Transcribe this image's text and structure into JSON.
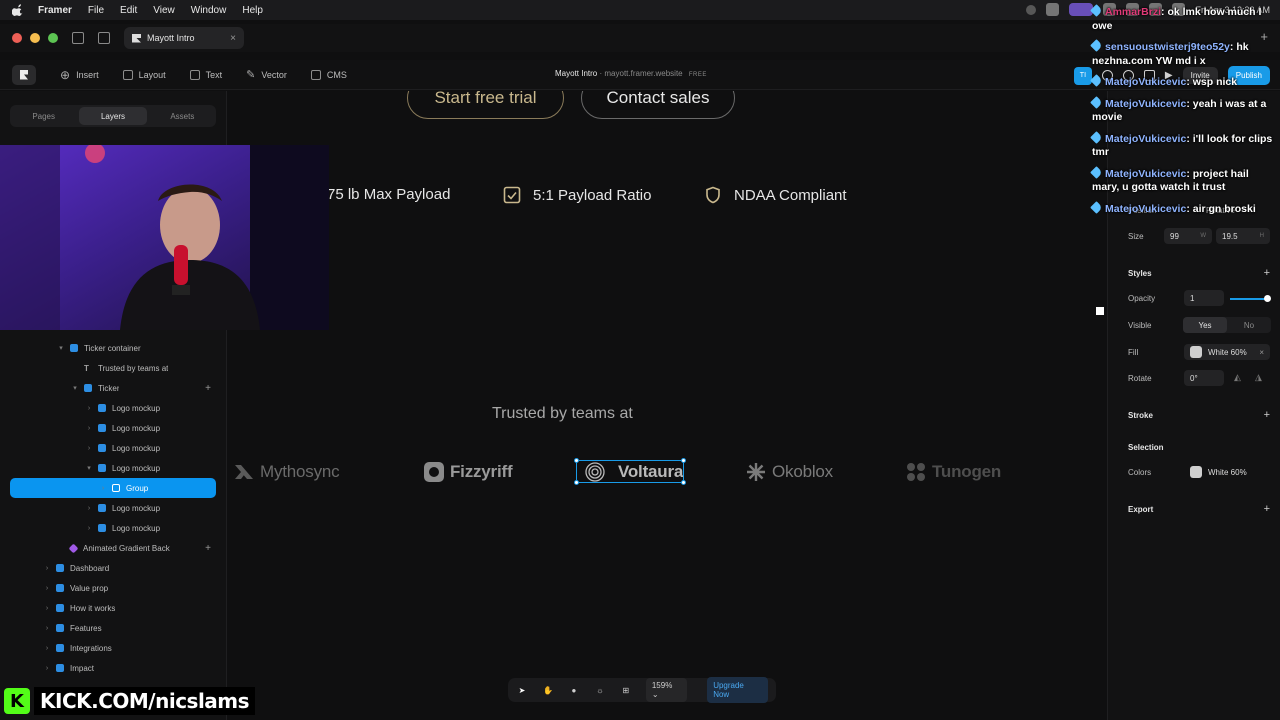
{
  "menubar": {
    "app": "Framer",
    "items": [
      "File",
      "Edit",
      "View",
      "Window",
      "Help"
    ],
    "clock": "Fri Apr 3  12:33 AM"
  },
  "tabbar": {
    "doc_tab": "Mayott Intro"
  },
  "toolbar": {
    "items": [
      "Insert",
      "Layout",
      "Text",
      "Vector",
      "CMS"
    ],
    "title": "Mayott Intro",
    "site": "mayott.framer.website",
    "plan": "FREE",
    "avatar": "TI",
    "invite": "Invite",
    "publish": "Publish"
  },
  "left_panel": {
    "tabs": [
      "Pages",
      "Layers",
      "Assets"
    ],
    "active_tab": "Layers",
    "layers": [
      {
        "label": "Ticker container",
        "depth": 2,
        "caret": "▾",
        "kind": "frame"
      },
      {
        "label": "Trusted by teams at",
        "depth": 3,
        "caret": "",
        "kind": "text"
      },
      {
        "label": "Ticker",
        "depth": 3,
        "caret": "▾",
        "kind": "frame",
        "plus": true
      },
      {
        "label": "Logo mockup",
        "depth": 4,
        "caret": "›",
        "kind": "frame"
      },
      {
        "label": "Logo mockup",
        "depth": 4,
        "caret": "›",
        "kind": "frame"
      },
      {
        "label": "Logo mockup",
        "depth": 4,
        "caret": "›",
        "kind": "frame"
      },
      {
        "label": "Logo mockup",
        "depth": 4,
        "caret": "▾",
        "kind": "frame"
      },
      {
        "label": "Group",
        "depth": 5,
        "caret": "›",
        "kind": "group",
        "selected": true
      },
      {
        "label": "Logo mockup",
        "depth": 4,
        "caret": "›",
        "kind": "frame"
      },
      {
        "label": "Logo mockup",
        "depth": 4,
        "caret": "›",
        "kind": "frame"
      },
      {
        "label": "Animated Gradient Back",
        "depth": 2,
        "caret": "",
        "kind": "component",
        "plus": true
      },
      {
        "label": "Dashboard",
        "depth": 1,
        "caret": "›",
        "kind": "frame"
      },
      {
        "label": "Value prop",
        "depth": 1,
        "caret": "›",
        "kind": "frame"
      },
      {
        "label": "How it works",
        "depth": 1,
        "caret": "›",
        "kind": "frame"
      },
      {
        "label": "Features",
        "depth": 1,
        "caret": "›",
        "kind": "frame"
      },
      {
        "label": "Integrations",
        "depth": 1,
        "caret": "›",
        "kind": "frame"
      },
      {
        "label": "Impact",
        "depth": 1,
        "caret": "›",
        "kind": "frame"
      }
    ]
  },
  "canvas": {
    "btn_trial": "Start free trial",
    "btn_sales": "Contact sales",
    "features": [
      "75 lb Max Payload",
      "5:1 Payload Ratio",
      "NDAA Compliant"
    ],
    "trusted": "Trusted by teams at",
    "logos": [
      {
        "name": "Mythosync",
        "color": "#6a6a6a"
      },
      {
        "name": "Fizzyriff",
        "color": "#9a9a9a"
      },
      {
        "name": "Voltaura",
        "color": "#b9b9b9"
      },
      {
        "name": "Okoblox",
        "color": "#7a7a7a"
      },
      {
        "name": "Tunogen",
        "color": "#4e4e4e"
      }
    ]
  },
  "bottombar": {
    "zoom": "159%",
    "upgrade": "Upgrade Now"
  },
  "right_panel": {
    "position_label": "Position",
    "position_value": "Relative",
    "size_label": "Size",
    "width": "99",
    "width_unit": "W",
    "height": "19.5",
    "height_unit": "H",
    "styles": "Styles",
    "opacity_label": "Opacity",
    "opacity": "1",
    "visible_label": "Visible",
    "yes": "Yes",
    "no": "No",
    "fill_label": "Fill",
    "fill": "White 60%",
    "rotate_label": "Rotate",
    "rotate": "0°",
    "stroke": "Stroke",
    "selection": "Selection",
    "colors_label": "Colors",
    "colors": "White 60%",
    "export": "Export"
  },
  "chat": [
    {
      "user": "AmmarBrzi",
      "text": "ok lmk how much I owe",
      "cls": "u1"
    },
    {
      "user": "sensuoustwisterj9teo52y",
      "text": "hk nezhna.com YW md i x",
      "cls": "u2"
    },
    {
      "user": "MatejoVukicevic",
      "text": "wsp nick",
      "cls": "u3"
    },
    {
      "user": "MatejoVukicevic",
      "text": "yeah i was at a movie",
      "cls": "u3"
    },
    {
      "user": "MatejoVukicevic",
      "text": "i'll look for clips tmr",
      "cls": "u3"
    },
    {
      "user": "MatejoVukicevic",
      "text": "project hail mary, u gotta watch it trust",
      "cls": "u3"
    },
    {
      "user": "MatejoVukicevic",
      "text": "air gn broski",
      "cls": "u3"
    }
  ],
  "stream": {
    "brand": "KICK.COM/nicslams"
  },
  "colors": {
    "accent": "#199be8",
    "selection": "#0a95f0",
    "kick_green": "#53fc18"
  }
}
